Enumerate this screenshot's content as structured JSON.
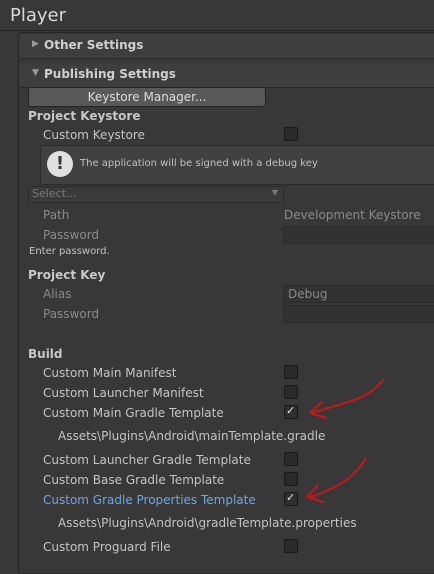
{
  "header": {
    "title": "Player"
  },
  "sections": {
    "other_settings": "Other Settings",
    "publishing_settings": "Publishing Settings"
  },
  "keystore_manager_button": "Keystore Manager...",
  "project_keystore": {
    "heading": "Project Keystore",
    "custom_keystore_label": "Custom Keystore",
    "custom_keystore_checked": false,
    "help_text": "The application will be signed with a debug key",
    "select_placeholder": "Select...",
    "path_label": "Path",
    "path_value": "Development Keystore",
    "password_label": "Password",
    "password_value": "",
    "enter_password_hint": "Enter password."
  },
  "project_key": {
    "heading": "Project Key",
    "alias_label": "Alias",
    "alias_value": "Debug",
    "password_label": "Password",
    "password_value": ""
  },
  "build": {
    "heading": "Build",
    "items": [
      {
        "label": "Custom Main Manifest",
        "checked": false
      },
      {
        "label": "Custom Launcher Manifest",
        "checked": false
      },
      {
        "label": "Custom Main Gradle Template",
        "checked": true
      },
      {
        "label": "Custom Launcher Gradle Template",
        "checked": false
      },
      {
        "label": "Custom Base Gradle Template",
        "checked": false
      },
      {
        "label": "Custom Gradle Properties Template",
        "checked": true
      },
      {
        "label": "Custom Proguard File",
        "checked": false
      }
    ],
    "main_template_path": "Assets\\Plugins\\Android\\mainTemplate.gradle",
    "gradle_template_path": "Assets\\Plugins\\Android\\gradleTemplate.properties"
  },
  "colors": {
    "annotation_arrow": "#c4161c",
    "highlight_label": "#6ca7e8"
  }
}
